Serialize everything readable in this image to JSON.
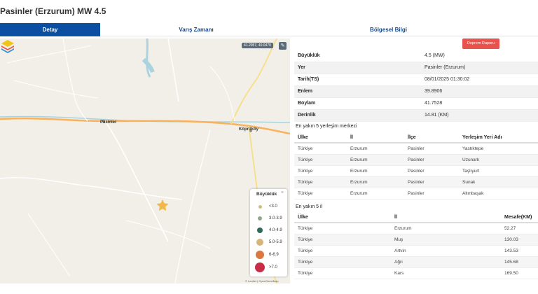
{
  "page": {
    "title": "Pasinler (Erzurum) MW 4.5"
  },
  "tabs": [
    {
      "label": "Detay",
      "active": true
    },
    {
      "label": "Varış Zamanı",
      "active": false
    },
    {
      "label": "Bölgesel Bilgi",
      "active": false
    }
  ],
  "map": {
    "coord_readout": "41.2057, 40.0470",
    "labels": {
      "pasinler": "Pasinler",
      "koprukoy": "Köprüköy"
    },
    "legend": {
      "title": "Büyüklük",
      "close": "×",
      "items": [
        {
          "label": "<3.0",
          "color": "#c9c07a"
        },
        {
          "label": "3.0-3.9",
          "color": "#8fa88a"
        },
        {
          "label": "4.0-4.9",
          "color": "#2f6b5a"
        },
        {
          "label": "5.0-5.9",
          "color": "#d8b478"
        },
        {
          "label": "6-6.9",
          "color": "#d97840"
        },
        {
          "label": ">7.0",
          "color": "#c92e48"
        }
      ]
    },
    "attribution": "© Leaflet | OpenStreetMap",
    "epicenter_color": "#f2b84b"
  },
  "report_button": "Deprem Raporu",
  "info": [
    {
      "key": "Büyüklük",
      "value": "4.5 (MW)"
    },
    {
      "key": "Yer",
      "value": "Pasinler (Erzurum)"
    },
    {
      "key": "Tarih(TS)",
      "value": "08/01/2025 01:30:02"
    },
    {
      "key": "Enlem",
      "value": "39.8906"
    },
    {
      "key": "Boylam",
      "value": "41.7528"
    },
    {
      "key": "Derinlik",
      "value": "14.81 (KM)"
    }
  ],
  "nearest_settlements": {
    "title": "En yakın 5 yerleşim merkezi",
    "headers": [
      "Ülke",
      "İl",
      "İlçe",
      "Yerleşim Yeri Adı"
    ],
    "rows": [
      [
        "Türkiye",
        "Erzurum",
        "Pasinler",
        "Yastıktepe"
      ],
      [
        "Türkiye",
        "Erzurum",
        "Pasinler",
        "Uzunark"
      ],
      [
        "Türkiye",
        "Erzurum",
        "Pasinler",
        "Taşlıyurt"
      ],
      [
        "Türkiye",
        "Erzurum",
        "Pasinler",
        "Sunak"
      ],
      [
        "Türkiye",
        "Erzurum",
        "Pasinler",
        "Altınbaşak"
      ]
    ]
  },
  "nearest_provinces": {
    "title": "En yakın 5 il",
    "headers": [
      "Ülke",
      "İl",
      "Mesafe(KM)"
    ],
    "rows": [
      [
        "Türkiye",
        "Erzurum",
        "52.27"
      ],
      [
        "Türkiye",
        "Muş",
        "130.03"
      ],
      [
        "Türkiye",
        "Artvin",
        "143.53"
      ],
      [
        "Türkiye",
        "Ağrı",
        "145.68"
      ],
      [
        "Türkiye",
        "Kars",
        "169.50"
      ]
    ]
  },
  "colors": {
    "accent": "#0b4ea2",
    "report": "#e8534d"
  }
}
